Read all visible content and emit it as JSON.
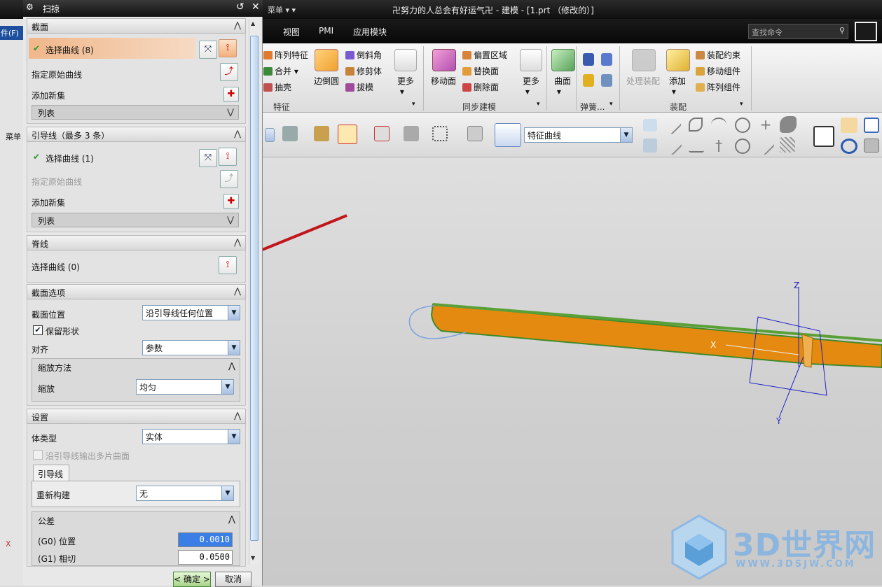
{
  "titlebar": {
    "window_title": "卍努力的人总会有好运气卍 - 建模 - [1.prt （修改的）]",
    "menu_label": "菜单",
    "menu_arrows": "▾ ▾"
  },
  "ribbon": {
    "tabs": [
      "视图",
      "PMI",
      "应用模块"
    ],
    "search_placeholder": "查找命令",
    "feature_group": {
      "label": "特征",
      "items": [
        "阵列特征",
        "合并",
        "抽壳",
        "边倒圆",
        "倒斜角",
        "修剪体",
        "拔模",
        "更多"
      ]
    },
    "sync_group": {
      "label": "同步建模",
      "items": [
        "移动面",
        "偏置区域",
        "替换面",
        "删除面",
        "更多"
      ]
    },
    "surface_item": "曲面",
    "spring_group": {
      "label": "弹簧..."
    },
    "assembly_group": {
      "label": "装配",
      "items": [
        "处理装配",
        "添加",
        "装配约束",
        "移动组件",
        "阵列组件"
      ]
    }
  },
  "toolbar2": {
    "filter_value": "特征曲线"
  },
  "left_strip": {
    "file_label": "件(F)",
    "menu_label": "菜单",
    "axis_label": "X"
  },
  "dialog": {
    "title": "扫掠",
    "section_profile": {
      "header": "截面",
      "select_curve": "选择曲线 (8)",
      "specify_origin": "指定原始曲线",
      "add_new_set": "添加新集",
      "list": "列表"
    },
    "section_guide": {
      "header": "引导线（最多 3 条）",
      "select_curve": "选择曲线 (1)",
      "specify_origin": "指定原始曲线",
      "add_new_set": "添加新集",
      "list": "列表"
    },
    "section_spine": {
      "header": "脊线",
      "select_curve": "选择曲线 (0)"
    },
    "section_options": {
      "header": "截面选项",
      "position_label": "截面位置",
      "position_value": "沿引导线任何位置",
      "preserve_shape": "保留形状",
      "preserve_checked": true,
      "align_label": "对齐",
      "align_value": "参数",
      "scaling_header": "缩放方法",
      "scale_label": "缩放",
      "scale_value": "均匀"
    },
    "section_settings": {
      "header": "设置",
      "body_type_label": "体类型",
      "body_type_value": "实体",
      "multi_surface_label": "沿引导线输出多片曲面",
      "multi_surface_checked": false,
      "guide_tab": "引导线",
      "rebuild_label": "重新构建",
      "rebuild_value": "无",
      "tolerance_header": "公差",
      "g0_label": "(G0) 位置",
      "g0_value": "0.0010",
      "g1_label": "(G1) 相切",
      "g1_value": "0.0500"
    },
    "ok_button": "< 确定 >",
    "cancel_button": "取消"
  },
  "viewport": {
    "axis_z": "Z",
    "axis_x": "X",
    "axis_y": "Y"
  },
  "watermark": {
    "brand": "3D世界网",
    "url": "WWW.3DSJW.COM"
  },
  "colors": {
    "sweep_body": "#e08a0c",
    "sweep_edge": "#3f8a2a",
    "arrow": "#c0161c",
    "csys": "#2020c8"
  }
}
